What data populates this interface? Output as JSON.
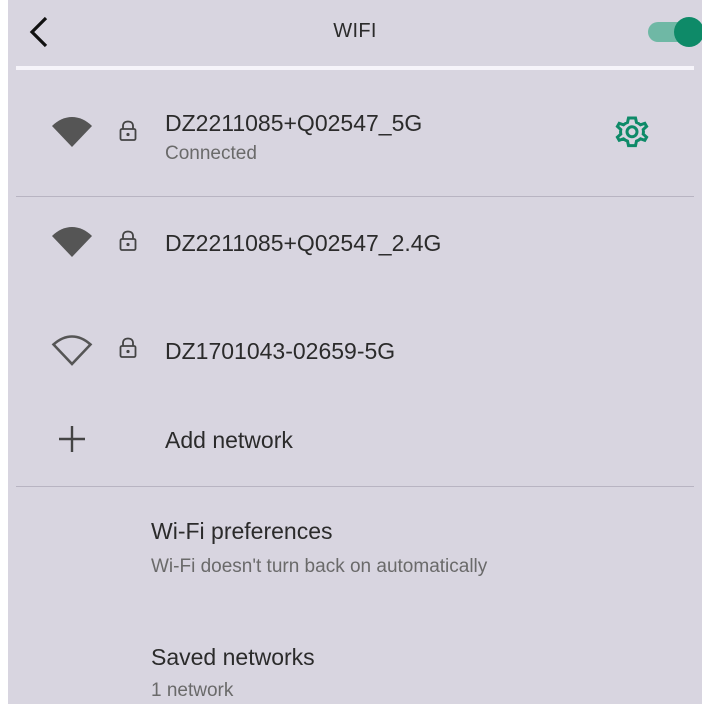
{
  "header": {
    "title": "WIFI",
    "back_icon": "chevron-left-icon",
    "wifi_toggle_on": true
  },
  "colors": {
    "background": "#d8d5e0",
    "accent": "#0e8a68",
    "toggle_track": "#6fb8a5",
    "icon": "#555555"
  },
  "networks": [
    {
      "name": "DZ2211085+Q02547_5G",
      "status": "Connected",
      "secured": true,
      "signal": "full",
      "settings_icon": "gear-icon"
    },
    {
      "name": "DZ2211085+Q02547_2.4G",
      "secured": true,
      "signal": "full"
    },
    {
      "name": "DZ1701043-02659-5G",
      "secured": true,
      "signal": "empty"
    }
  ],
  "add_network": {
    "label": "Add network",
    "icon": "plus-icon"
  },
  "preferences": {
    "title": "Wi-Fi preferences",
    "subtitle": "Wi-Fi doesn't turn back on automatically"
  },
  "saved_networks": {
    "title": "Saved networks",
    "subtitle": "1 network"
  }
}
